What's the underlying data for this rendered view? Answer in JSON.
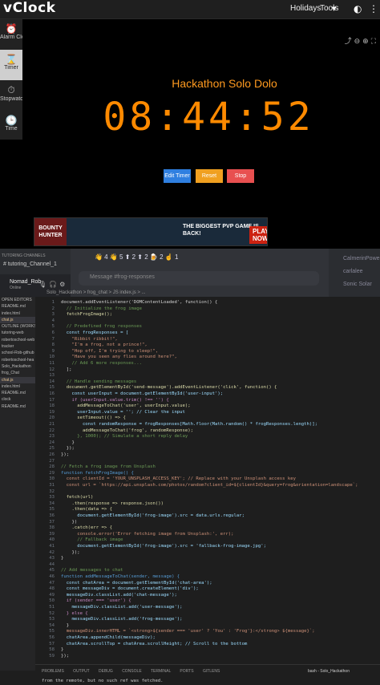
{
  "app": {
    "logo": "vClock",
    "nav": [
      "Holidays",
      "Tools"
    ]
  },
  "sidebar": {
    "items": [
      {
        "label": "Alarm Clock",
        "icon": "alarm-icon"
      },
      {
        "label": "Timer",
        "icon": "hourglass-icon"
      },
      {
        "label": "Stopwatch",
        "icon": "stopwatch-icon"
      },
      {
        "label": "Time",
        "icon": "clock-icon"
      }
    ]
  },
  "timer": {
    "title": "Hackathon Solo Dolo",
    "display": "08:44:52",
    "progress_text": "08:44:52"
  },
  "buttons": {
    "edit": "Edit Timer",
    "reset": "Reset",
    "stop": "Stop"
  },
  "ad": {
    "left": "BOUNTY HUNTER",
    "middle": "THE BIGGEST PVP GAME IS BACK!",
    "cta": "PLAY NOW"
  },
  "discord": {
    "category": "TUTORING CHANNELS",
    "channel": "# tutoring_Channel_1",
    "user": {
      "name": "Nomad_Rob",
      "status": "Online"
    },
    "reactions": "👋 4  👋 5  ⬆ 2  ⬆ 2  🍺 2  ☝ 1",
    "placeholder": "Message #frog-responses",
    "members": [
      "CalmerinPower",
      "carlalee",
      "Sonic Solar"
    ]
  },
  "editor": {
    "breadcrumb": "Solo_Hackathon > frog_chat > JS index.js > ...",
    "explorer": [
      "OPEN EDITORS",
      "README.md",
      "index.html",
      "chat.js",
      "OUTLINE (WORKSPACE)",
      "tutoring-web",
      "robertoschool-web",
      "tracker",
      "school-Rob-github",
      "robertoschool-hea",
      "Solo_Hackathon",
      "frog_Chat",
      "chat.js",
      "index.html",
      "README.md",
      "clock",
      "README.md"
    ],
    "code": [
      {
        "n": "1",
        "t": "document.addEventListener('DOMContentLoaded', function() {",
        "c": "#d4d4d4"
      },
      {
        "n": "2",
        "t": "  // Initialize the frog image",
        "c": "#6a9955"
      },
      {
        "n": "3",
        "t": "  fetchFrogImage();",
        "c": "#dcdcaa"
      },
      {
        "n": "4",
        "t": "",
        "c": "#d4d4d4"
      },
      {
        "n": "5",
        "t": "  // Predefined frog responses",
        "c": "#6a9955"
      },
      {
        "n": "6",
        "t": "  const frogResponses = [",
        "c": "#9cdcfe"
      },
      {
        "n": "7",
        "t": "    \"Ribbit ribbit!\",",
        "c": "#ce9178"
      },
      {
        "n": "8",
        "t": "    \"I'm a frog, not a prince!\",",
        "c": "#ce9178"
      },
      {
        "n": "9",
        "t": "    \"Hop off, I'm trying to sleep!\",",
        "c": "#ce9178"
      },
      {
        "n": "10",
        "t": "    \"Have you seen any flies around here?\",",
        "c": "#ce9178"
      },
      {
        "n": "11",
        "t": "    // Add 6 more responses...",
        "c": "#6a9955"
      },
      {
        "n": "12",
        "t": "  ];",
        "c": "#d4d4d4"
      },
      {
        "n": "13",
        "t": "",
        "c": "#d4d4d4"
      },
      {
        "n": "14",
        "t": "  // Handle sending messages",
        "c": "#6a9955"
      },
      {
        "n": "15",
        "t": "  document.getElementById('send-message').addEventListener('click', function() {",
        "c": "#dcdcaa"
      },
      {
        "n": "16",
        "t": "    const userInput = document.getElementById('user-input');",
        "c": "#9cdcfe"
      },
      {
        "n": "17",
        "t": "    if (userInput.value.trim() !== '') {",
        "c": "#c586c0"
      },
      {
        "n": "18",
        "t": "      addMessageToChat('user', userInput.value);",
        "c": "#dcdcaa"
      },
      {
        "n": "19",
        "t": "      userInput.value = ''; // Clear the input",
        "c": "#9cdcfe"
      },
      {
        "n": "20",
        "t": "      setTimeout(() => {",
        "c": "#dcdcaa"
      },
      {
        "n": "21",
        "t": "        const randomResponse = frogResponses[Math.floor(Math.random() * frogResponses.length)];",
        "c": "#9cdcfe"
      },
      {
        "n": "22",
        "t": "        addMessageToChat('frog', randomResponse);",
        "c": "#dcdcaa"
      },
      {
        "n": "23",
        "t": "      }, 1000); // Simulate a short reply delay",
        "c": "#6a9955"
      },
      {
        "n": "24",
        "t": "    }",
        "c": "#d4d4d4"
      },
      {
        "n": "25",
        "t": "  });",
        "c": "#d4d4d4"
      },
      {
        "n": "26",
        "t": "});",
        "c": "#d4d4d4"
      },
      {
        "n": "27",
        "t": "",
        "c": "#d4d4d4"
      },
      {
        "n": "28",
        "t": "// Fetch a frog image from Unsplash",
        "c": "#6a9955"
      },
      {
        "n": "29",
        "t": "function fetchFrogImage() {",
        "c": "#569cd6"
      },
      {
        "n": "30",
        "t": "  const clientId = 'YOUR_UNSPLASH_ACCESS_KEY'; // Replace with your Unsplash access key",
        "c": "#ce9178"
      },
      {
        "n": "31",
        "t": "  const url = `https://api.unsplash.com/photos/random?client_id=${clientId}&query=frog&orientation=landscape`;",
        "c": "#ce9178"
      },
      {
        "n": "32",
        "t": "",
        "c": "#d4d4d4"
      },
      {
        "n": "33",
        "t": "  fetch(url)",
        "c": "#dcdcaa"
      },
      {
        "n": "34",
        "t": "    .then(response => response.json())",
        "c": "#dcdcaa"
      },
      {
        "n": "35",
        "t": "    .then(data => {",
        "c": "#dcdcaa"
      },
      {
        "n": "36",
        "t": "      document.getElementById('frog-image').src = data.urls.regular;",
        "c": "#9cdcfe"
      },
      {
        "n": "37",
        "t": "    })",
        "c": "#d4d4d4"
      },
      {
        "n": "38",
        "t": "    .catch(err => {",
        "c": "#dcdcaa"
      },
      {
        "n": "39",
        "t": "      console.error('Error fetching image from Unsplash:', err);",
        "c": "#ce9178"
      },
      {
        "n": "40",
        "t": "      // Fallback image",
        "c": "#6a9955"
      },
      {
        "n": "41",
        "t": "      document.getElementById('frog-image').src = 'fallback-frog-image.jpg';",
        "c": "#9cdcfe"
      },
      {
        "n": "42",
        "t": "    });",
        "c": "#d4d4d4"
      },
      {
        "n": "43",
        "t": "}",
        "c": "#d4d4d4"
      },
      {
        "n": "44",
        "t": "",
        "c": "#d4d4d4"
      },
      {
        "n": "45",
        "t": "// Add messages to chat",
        "c": "#6a9955"
      },
      {
        "n": "46",
        "t": "function addMessageToChat(sender, message) {",
        "c": "#569cd6"
      },
      {
        "n": "47",
        "t": "  const chatArea = document.getElementById('chat-area');",
        "c": "#9cdcfe"
      },
      {
        "n": "48",
        "t": "  const messageDiv = document.createElement('div');",
        "c": "#9cdcfe"
      },
      {
        "n": "49",
        "t": "  messageDiv.classList.add('chat-message');",
        "c": "#9cdcfe"
      },
      {
        "n": "50",
        "t": "  if (sender === 'user') {",
        "c": "#c586c0"
      },
      {
        "n": "51",
        "t": "    messageDiv.classList.add('user-message');",
        "c": "#9cdcfe"
      },
      {
        "n": "52",
        "t": "  } else {",
        "c": "#c586c0"
      },
      {
        "n": "53",
        "t": "    messageDiv.classList.add('frog-message');",
        "c": "#9cdcfe"
      },
      {
        "n": "54",
        "t": "  }",
        "c": "#d4d4d4"
      },
      {
        "n": "55",
        "t": "  messageDiv.innerHTML = `<strong>${sender === 'user' ? 'You' : 'Frog'}:</strong> ${message}`;",
        "c": "#ce9178"
      },
      {
        "n": "56",
        "t": "  chatArea.appendChild(messageDiv);",
        "c": "#9cdcfe"
      },
      {
        "n": "57",
        "t": "  chatArea.scrollTop = chatArea.scrollHeight; // Scroll to the bottom",
        "c": "#9cdcfe"
      },
      {
        "n": "58",
        "t": "}",
        "c": "#d4d4d4"
      },
      {
        "n": "59",
        "t": "});",
        "c": "#d4d4d4"
      }
    ],
    "panel_tabs": "PROBLEMS OUTPUT DEBUG CONSOLE TERMINAL PORTS GITLENS",
    "terminal_line": "from the remote, but no such ref was fetched.",
    "shell": "bash - Solo_Hackathon"
  },
  "colors": {
    "timer": "#ff8a00",
    "edit": "#2f7fe0",
    "reset": "#f0a020",
    "stop": "#e85050"
  }
}
